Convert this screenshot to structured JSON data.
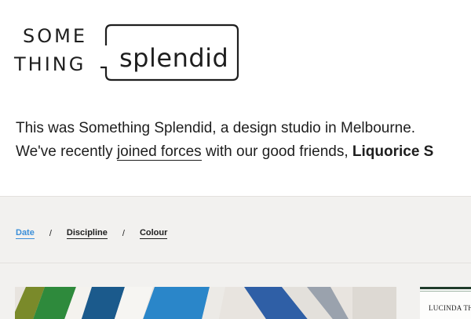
{
  "brand": {
    "logo_top": "SOME",
    "logo_bottom": "THING",
    "logo_splendid": "splendid"
  },
  "intro": {
    "line1": "This was Something Splendid, a design studio in Melbourne.",
    "line2_prefix": "We've recently ",
    "line2_link": "joined forces",
    "line2_mid": " with our good friends, ",
    "line2_bold": "Liquorice S"
  },
  "filters": {
    "items": [
      {
        "label": "Date",
        "active": true
      },
      {
        "label": "Discipline",
        "active": false
      },
      {
        "label": "Colour",
        "active": false
      }
    ],
    "separator": "/"
  },
  "cards": {
    "side_label": "LUCINDA THOMS"
  },
  "colors": {
    "accent": "#3b8fd9",
    "text": "#1e1e1e",
    "background": "#f2f1ef",
    "header_bg": "#ffffff"
  }
}
